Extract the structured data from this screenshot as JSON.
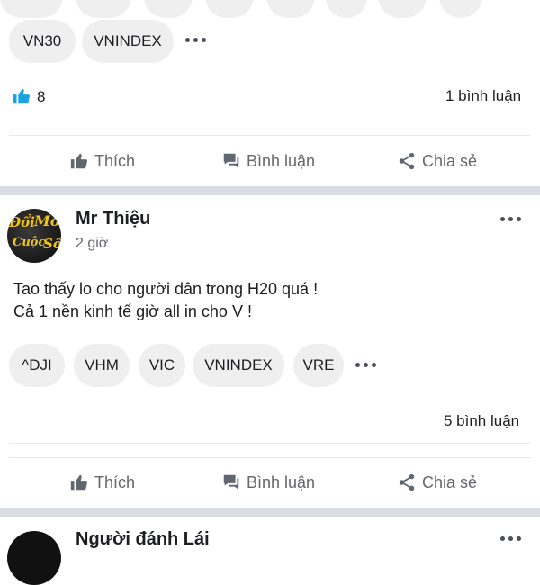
{
  "post1": {
    "tags": [
      "VN30",
      "VNINDEX"
    ],
    "like_count": "8",
    "comment_count": "1 bình luận",
    "actions": {
      "like": "Thích",
      "comment": "Bình luận",
      "share": "Chia sẻ"
    }
  },
  "post2": {
    "author": "Mr Thiệu",
    "time": "2 giờ",
    "body_line1": "Tao thấy lo cho người dân trong H20 quá !",
    "body_line2": "Cả 1 nền kinh tế giờ all in cho V !",
    "tags": [
      "^DJI",
      "VHM",
      "VIC",
      "VNINDEX",
      "VRE"
    ],
    "comment_count": "5 bình luận",
    "actions": {
      "like": "Thích",
      "comment": "Bình luận",
      "share": "Chia sẻ"
    },
    "avatar_text": "Đổi Mới Cuộc Sống"
  },
  "post3": {
    "author": "Người đánh Lái"
  },
  "colors": {
    "like_blue": "#1877f2",
    "pill_bg": "#efefef",
    "separator": "#dadde1",
    "muted_text": "#65676b"
  }
}
